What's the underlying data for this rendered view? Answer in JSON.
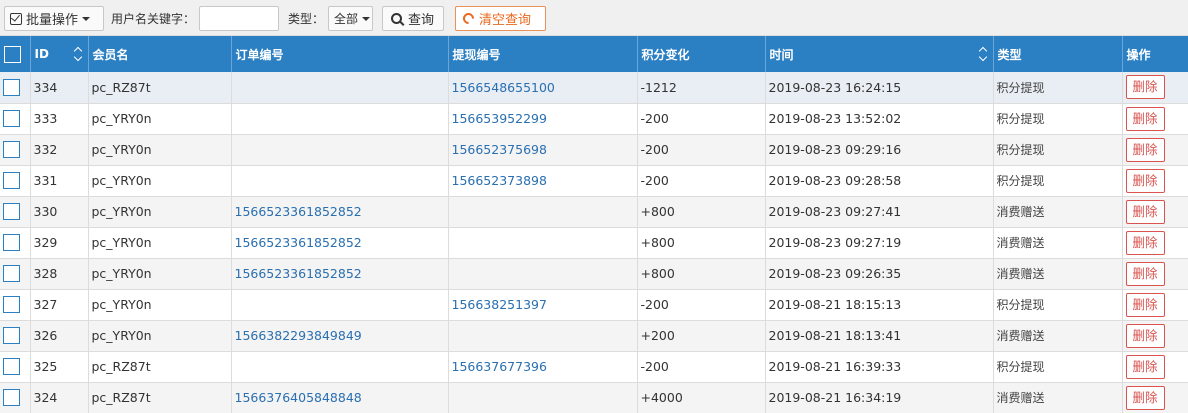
{
  "toolbar": {
    "batch_label": "批量操作",
    "keyword_label": "用户名关键字：",
    "keyword_value": "",
    "type_label": "类型：",
    "type_selected": "全部",
    "search_label": "查询",
    "clear_label": "清空查询"
  },
  "table": {
    "headers": [
      "ID",
      "会员名",
      "订单编号",
      "提现编号",
      "积分变化",
      "时间",
      "类型",
      "操作"
    ],
    "rows": [
      {
        "id": "334",
        "member": "pc_RZ87t",
        "order_no": "",
        "withdraw_no": "1566548655100",
        "points": "-1212",
        "time": "2019-08-23 16:24:15",
        "type": "积分提现",
        "action": "删除"
      },
      {
        "id": "333",
        "member": "pc_YRY0n",
        "order_no": "",
        "withdraw_no": "156653952299",
        "points": "-200",
        "time": "2019-08-23 13:52:02",
        "type": "积分提现",
        "action": "删除"
      },
      {
        "id": "332",
        "member": "pc_YRY0n",
        "order_no": "",
        "withdraw_no": "156652375698",
        "points": "-200",
        "time": "2019-08-23 09:29:16",
        "type": "积分提现",
        "action": "删除"
      },
      {
        "id": "331",
        "member": "pc_YRY0n",
        "order_no": "",
        "withdraw_no": "156652373898",
        "points": "-200",
        "time": "2019-08-23 09:28:58",
        "type": "积分提现",
        "action": "删除"
      },
      {
        "id": "330",
        "member": "pc_YRY0n",
        "order_no": "1566523361852852",
        "withdraw_no": "",
        "points": "+800",
        "time": "2019-08-23 09:27:41",
        "type": "消费赠送",
        "action": "删除"
      },
      {
        "id": "329",
        "member": "pc_YRY0n",
        "order_no": "1566523361852852",
        "withdraw_no": "",
        "points": "+800",
        "time": "2019-08-23 09:27:19",
        "type": "消费赠送",
        "action": "删除"
      },
      {
        "id": "328",
        "member": "pc_YRY0n",
        "order_no": "1566523361852852",
        "withdraw_no": "",
        "points": "+800",
        "time": "2019-08-23 09:26:35",
        "type": "消费赠送",
        "action": "删除"
      },
      {
        "id": "327",
        "member": "pc_YRY0n",
        "order_no": "",
        "withdraw_no": "156638251397",
        "points": "-200",
        "time": "2019-08-21 18:15:13",
        "type": "积分提现",
        "action": "删除"
      },
      {
        "id": "326",
        "member": "pc_YRY0n",
        "order_no": "1566382293849849",
        "withdraw_no": "",
        "points": "+200",
        "time": "2019-08-21 18:13:41",
        "type": "消费赠送",
        "action": "删除"
      },
      {
        "id": "325",
        "member": "pc_RZ87t",
        "order_no": "",
        "withdraw_no": "156637677396",
        "points": "-200",
        "time": "2019-08-21 16:39:33",
        "type": "积分提现",
        "action": "删除"
      },
      {
        "id": "324",
        "member": "pc_RZ87t",
        "order_no": "1566376405848848",
        "withdraw_no": "",
        "points": "+4000",
        "time": "2019-08-21 16:34:19",
        "type": "消费赠送",
        "action": "删除"
      }
    ]
  },
  "colors": {
    "header_bg": "#2b7fc3",
    "link": "#2a6fb0",
    "danger": "#d9534f",
    "clear_accent": "#e8691f"
  },
  "icons": [
    "check-square-icon",
    "caret-down-icon",
    "search-icon",
    "refresh-icon",
    "sort-icon"
  ]
}
